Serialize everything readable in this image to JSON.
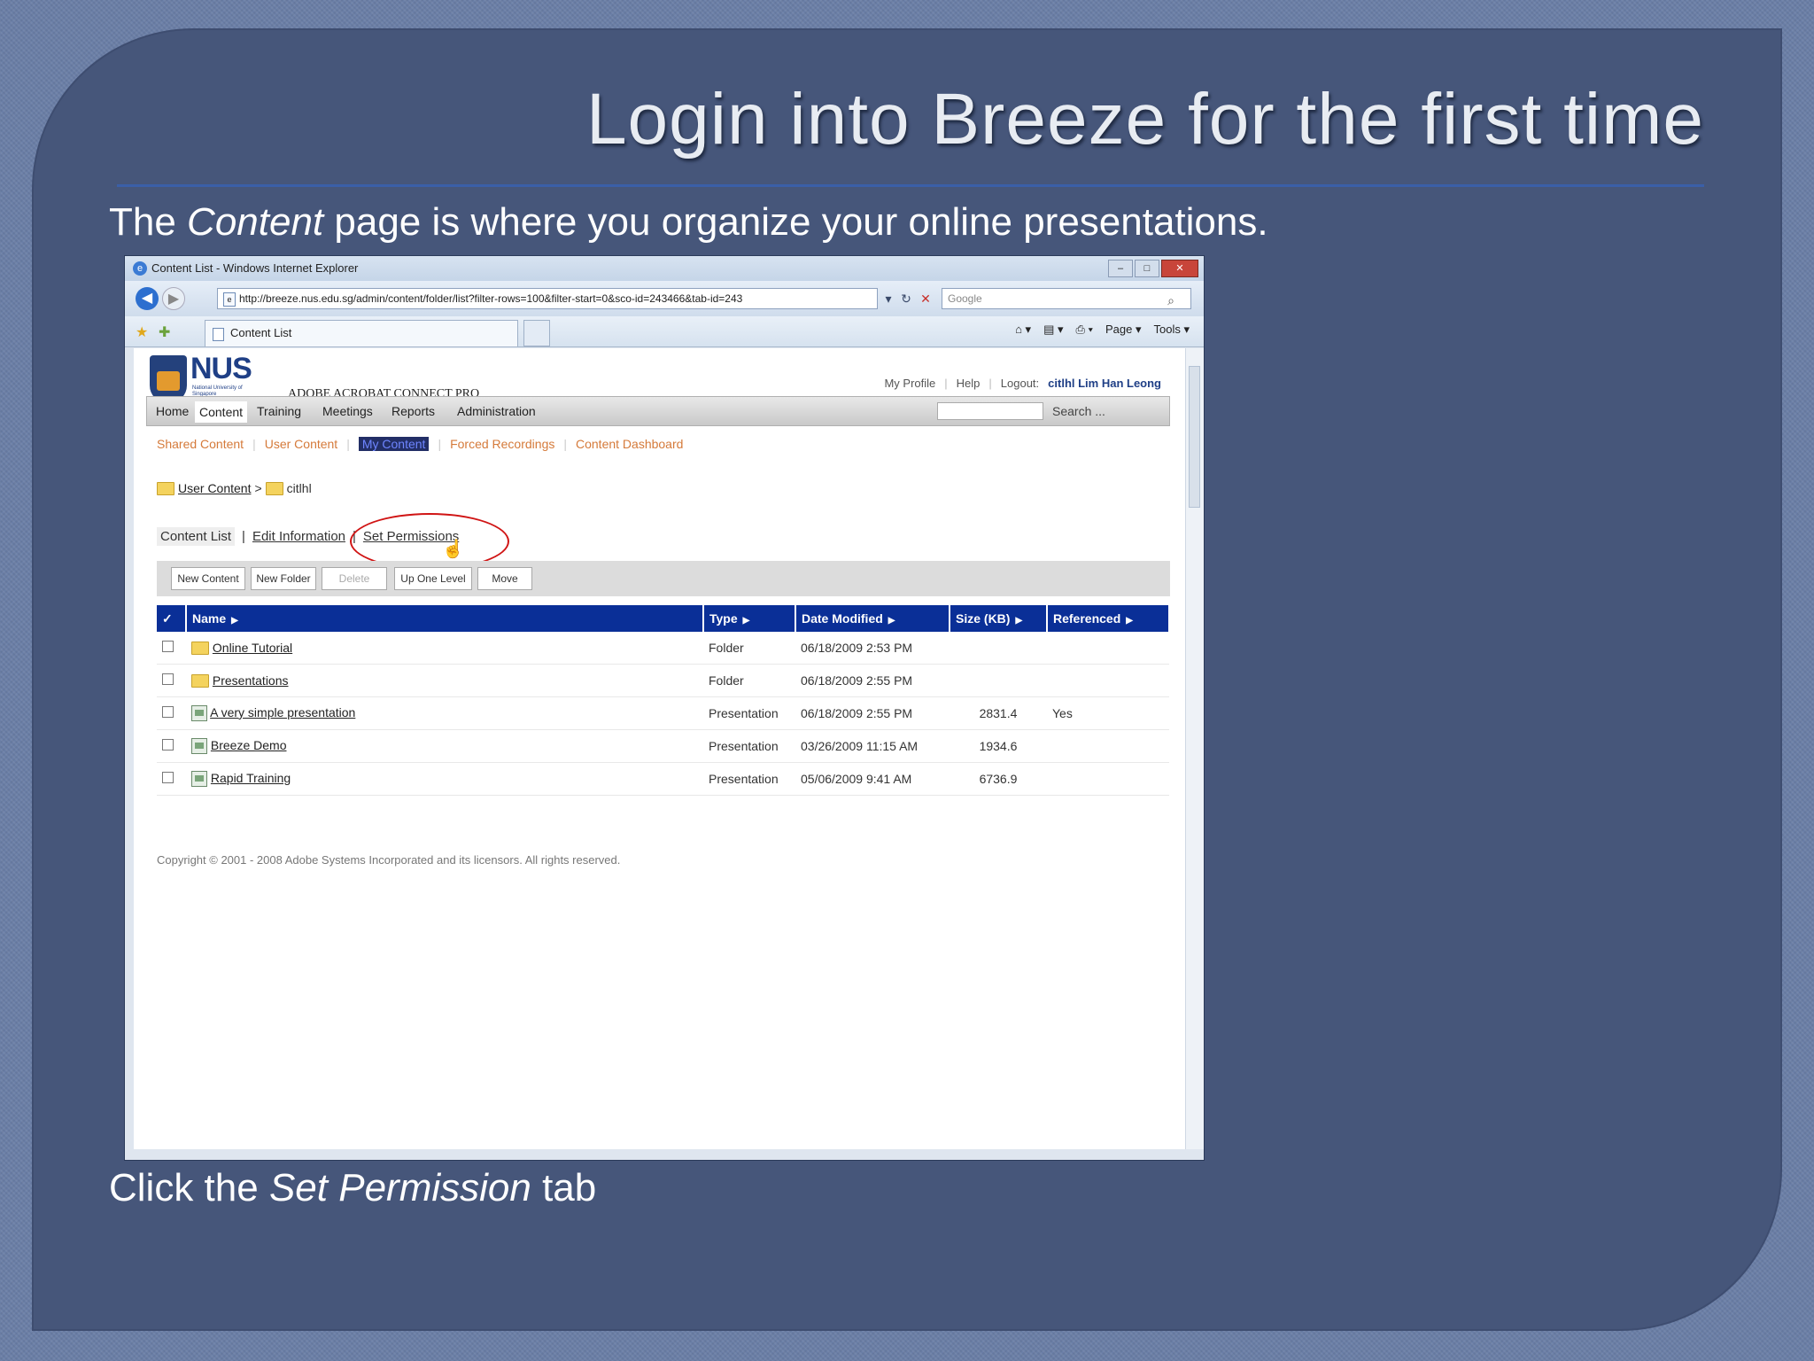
{
  "slide": {
    "title": "Login into Breeze for the first time",
    "intro_before": "The ",
    "intro_em": "Content",
    "intro_after": " page is where you organize your online presentations.",
    "outro_before": "Click the ",
    "outro_em": "Set Permission",
    "outro_after": " tab"
  },
  "browser": {
    "window_title": "Content List - Windows Internet Explorer",
    "window_buttons": [
      "–",
      "□",
      "✕"
    ],
    "url": "http://breeze.nus.edu.sg/admin/content/folder/list?filter-rows=100&filter-start=0&sco-id=243466&tab-id=243",
    "search_placeholder": "Google",
    "tab_title": "Content List",
    "command_bar": [
      "Page ▾",
      "Tools ▾"
    ]
  },
  "app": {
    "logo_text": "NUS",
    "logo_subtext": "National University of Singapore",
    "product_name": "ADOBE ACROBAT CONNECT PRO",
    "top_links": {
      "my_profile": "My Profile",
      "help": "Help",
      "logout_label": "Logout:",
      "user": "citlhl Lim Han Leong"
    },
    "main_menu": [
      "Home",
      "Content",
      "Training",
      "Meetings",
      "Reports",
      "Administration"
    ],
    "active_menu": "Content",
    "search_label": "Search ...",
    "sub_menu": [
      "Shared Content",
      "User Content",
      "My Content",
      "Forced Recordings",
      "Content Dashboard"
    ],
    "active_sub_menu": "My Content",
    "breadcrumb": {
      "parent": "User Content",
      "separator": ">",
      "current": "citlhl"
    },
    "content_tabs": {
      "current": "Content List",
      "edit": "Edit Information",
      "permissions": "Set Permissions",
      "separator": "|"
    },
    "buttons": [
      "New Content",
      "New Folder",
      "Delete",
      "Up One Level",
      "Move"
    ],
    "table": {
      "headers": [
        "Name",
        "Type",
        "Date Modified",
        "Size (KB)",
        "Referenced"
      ],
      "check_all": "✓",
      "rows": [
        {
          "icon": "folder-icon",
          "name": "Online Tutorial",
          "type": "Folder",
          "date": "06/18/2009 2:53 PM",
          "size": "",
          "referenced": ""
        },
        {
          "icon": "folder-icon",
          "name": "Presentations",
          "type": "Folder",
          "date": "06/18/2009 2:55 PM",
          "size": "",
          "referenced": ""
        },
        {
          "icon": "presentation-icon",
          "name": "A very simple presentation",
          "type": "Presentation",
          "date": "06/18/2009 2:55 PM",
          "size": "2831.4",
          "referenced": "Yes"
        },
        {
          "icon": "presentation-icon",
          "name": "Breeze Demo",
          "type": "Presentation",
          "date": "03/26/2009 11:15 AM",
          "size": "1934.6",
          "referenced": ""
        },
        {
          "icon": "presentation-icon",
          "name": "Rapid Training",
          "type": "Presentation",
          "date": "05/06/2009 9:41 AM",
          "size": "6736.9",
          "referenced": ""
        }
      ]
    },
    "copyright": "Copyright © 2001 - 2008 Adobe Systems Incorporated and its licensors. All rights reserved."
  },
  "colors": {
    "panel_bg": "#46567a",
    "table_header": "#0a2f97",
    "submenu_link": "#d57a3a",
    "highlight_ellipse": "#d01414"
  }
}
